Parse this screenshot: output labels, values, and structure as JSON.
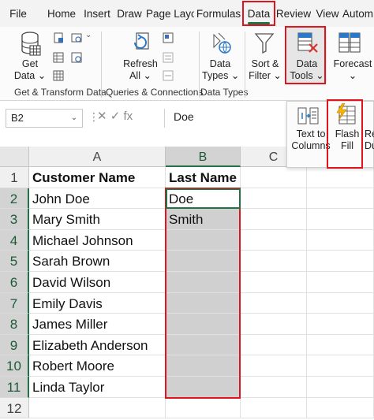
{
  "tabs": [
    {
      "label": "File"
    },
    {
      "label": "Home"
    },
    {
      "label": "Insert"
    },
    {
      "label": "Draw"
    },
    {
      "label": "Page Layo"
    },
    {
      "label": "Formulas"
    },
    {
      "label": "Data"
    },
    {
      "label": "Review"
    },
    {
      "label": "View"
    },
    {
      "label": "Autom"
    }
  ],
  "ribbon": {
    "get_data": {
      "line1": "Get",
      "line2": "Data ⌄"
    },
    "refresh": {
      "line1": "Refresh",
      "line2": "All ⌄"
    },
    "data_types": {
      "line1": "Data",
      "line2": "Types ⌄"
    },
    "sort_filter": {
      "line1": "Sort &",
      "line2": "Filter ⌄"
    },
    "data_tools": {
      "line1": "Data",
      "line2": "Tools ⌄"
    },
    "forecast": {
      "line1": "Forecast",
      "line2": "⌄"
    },
    "group_labels": {
      "get_transform": "Get & Transform Data",
      "queries": "Queries & Connections",
      "data_types": "Data Types"
    }
  },
  "data_tools_panel": {
    "text_to_columns": {
      "line1": "Text to",
      "line2": "Columns"
    },
    "flash_fill": {
      "line1": "Flash",
      "line2": "Fill"
    },
    "partial": {
      "line1": "Re",
      "line2": "Du"
    }
  },
  "formula_bar": {
    "name_box": "B2",
    "dots": "⋮",
    "icons": "✕  ✓  fx",
    "content": "Doe"
  },
  "columns": [
    "A",
    "B",
    "C"
  ],
  "rows": [
    {
      "num": "1",
      "a": "Customer Name",
      "b": "Last Name"
    },
    {
      "num": "2",
      "a": "John Doe",
      "b": "Doe"
    },
    {
      "num": "3",
      "a": "Mary Smith",
      "b": "Smith"
    },
    {
      "num": "4",
      "a": "Michael Johnson",
      "b": ""
    },
    {
      "num": "5",
      "a": "Sarah Brown",
      "b": ""
    },
    {
      "num": "6",
      "a": "David Wilson",
      "b": ""
    },
    {
      "num": "7",
      "a": "Emily Davis",
      "b": ""
    },
    {
      "num": "8",
      "a": "James Miller",
      "b": ""
    },
    {
      "num": "9",
      "a": "Elizabeth Anderson",
      "b": ""
    },
    {
      "num": "10",
      "a": "Robert Moore",
      "b": ""
    },
    {
      "num": "11",
      "a": "Linda Taylor",
      "b": ""
    },
    {
      "num": "12",
      "a": "",
      "b": ""
    }
  ],
  "colors": {
    "excel_green": "#217346",
    "highlight_red": "#e0141e",
    "selection_gray": "#d0d0d0"
  }
}
